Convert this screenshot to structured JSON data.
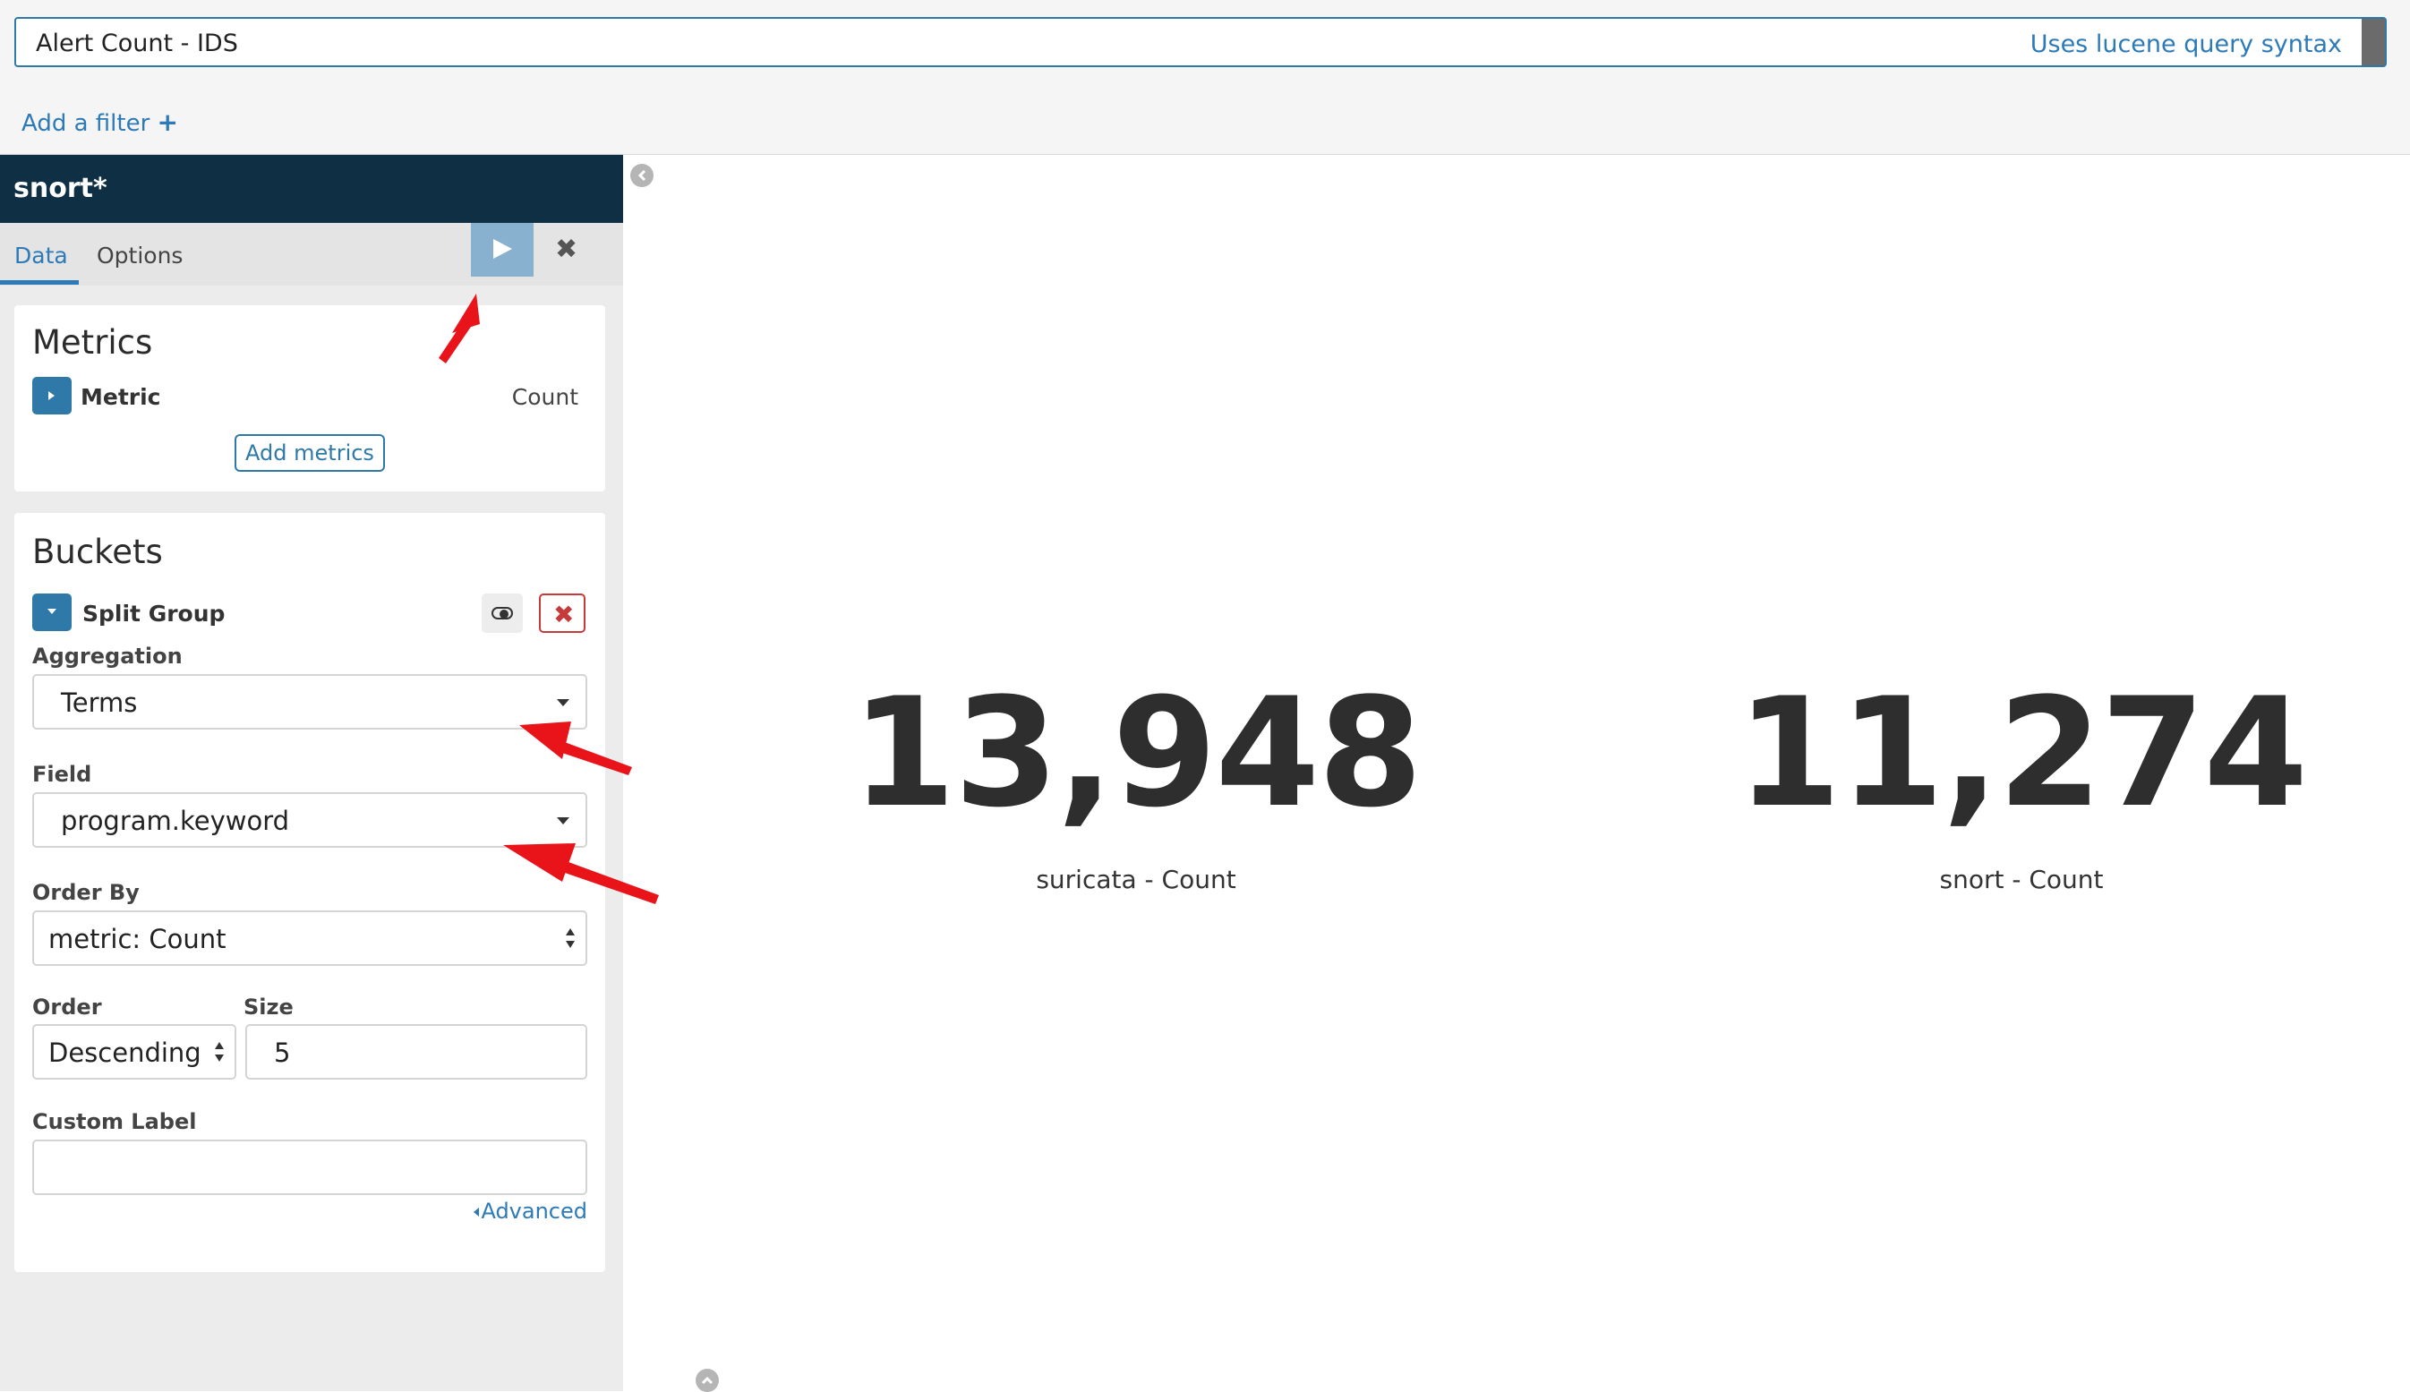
{
  "query": {
    "value": "Alert Count - IDS",
    "syntax_link": "Uses lucene query syntax"
  },
  "filter": {
    "add_label": "Add a filter",
    "add_icon": "+"
  },
  "sidebar": {
    "index_pattern": "snort*",
    "tabs": [
      {
        "label": "Data",
        "active": true
      },
      {
        "label": "Options",
        "active": false
      }
    ],
    "apply_icon": "play-icon",
    "discard_icon": "✖",
    "metrics": {
      "title": "Metrics",
      "metric_label": "Metric",
      "metric_value": "Count",
      "add_button": "Add metrics"
    },
    "buckets": {
      "title": "Buckets",
      "group_label": "Split Group",
      "remove_icon": "✖",
      "aggregation_label": "Aggregation",
      "aggregation_value": "Terms",
      "field_label": "Field",
      "field_value": "program.keyword",
      "order_by_label": "Order By",
      "order_by_value": "metric: Count",
      "order_label": "Order",
      "order_value": "Descending",
      "size_label": "Size",
      "size_value": "5",
      "custom_label_label": "Custom Label",
      "custom_label_value": "",
      "advanced_link": "Advanced"
    }
  },
  "visualization": {
    "metrics": [
      {
        "value": "13,948",
        "label": "suricata - Count"
      },
      {
        "value": "11,274",
        "label": "snort - Count"
      }
    ]
  },
  "colors": {
    "accent": "#2e79a8",
    "header_dark": "#0e2f44",
    "annotation_arrow": "#e8141a",
    "remove_red": "#c53a3a"
  }
}
